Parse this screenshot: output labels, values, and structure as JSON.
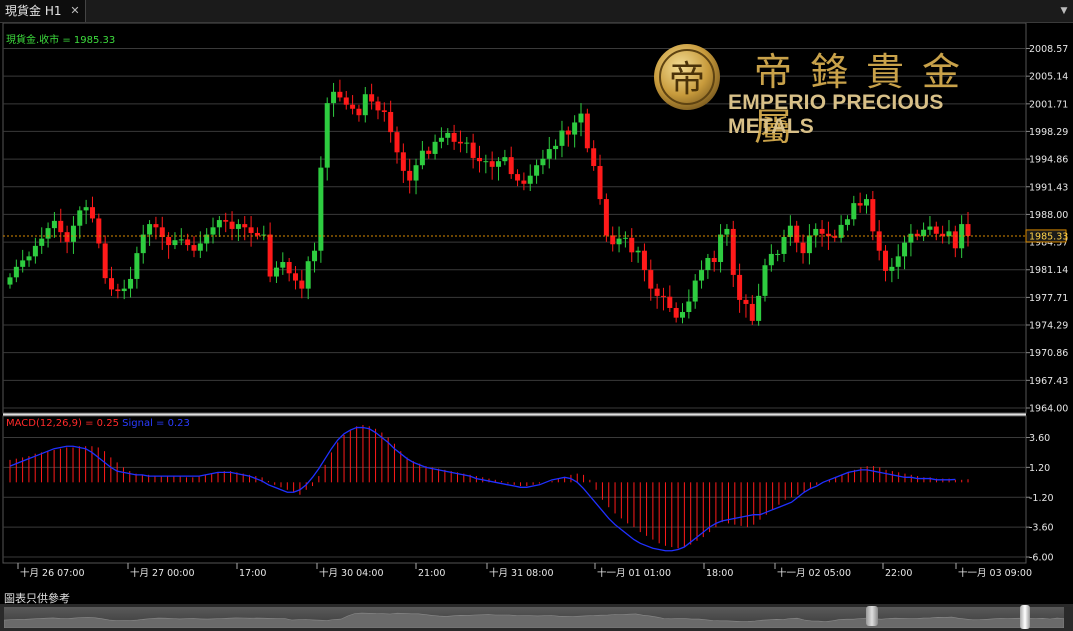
{
  "tab": {
    "title": "現貨金 H1",
    "close_glyph": "✕"
  },
  "window": {
    "dropdown_glyph": "▼"
  },
  "price_legend": "現貨金.收市 = 1985.33",
  "current_price": "1985.33",
  "price_axis": [
    "2008.57",
    "2005.14",
    "2001.71",
    "1998.29",
    "1994.86",
    "1991.43",
    "1988.00",
    "1984.57",
    "1981.14",
    "1977.71",
    "1974.29",
    "1970.86",
    "1967.43",
    "1964.00"
  ],
  "macd_legend": {
    "name": "MACD(12,26,9) = 0.25",
    "signal": "Signal = 0.23"
  },
  "macd_axis": [
    "3.60",
    "1.20",
    "-1.20",
    "-3.60",
    "-6.00"
  ],
  "time_axis": [
    "十月 26 07:00",
    "十月 27 00:00",
    "17:00",
    "十月 30 04:00",
    "21:00",
    "十月 31 08:00",
    "十一月 01 01:00",
    "18:00",
    "十一月 02 05:00",
    "22:00",
    "十一月 03 09:00"
  ],
  "logo": {
    "cn": "帝鋒貴金屬",
    "en": "EMPERIO PRECIOUS METALS",
    "emblem": "帝"
  },
  "disclaimer": "圖表只供參考",
  "colors": {
    "up": "#2ecc40",
    "down": "#ff1a1a",
    "signal": "#2030ff",
    "price_line": "#d98a00",
    "grid": "#3a3a3a",
    "gold": "#c9a24a"
  },
  "chart_data": [
    {
      "type": "candlestick",
      "title": "現貨金 H1",
      "ylim": [
        1964.0,
        2010.0
      ],
      "ticks": [
        2008.57,
        2005.14,
        2001.71,
        1998.29,
        1994.86,
        1991.43,
        1988.0,
        1984.57,
        1981.14,
        1977.71,
        1974.29,
        1970.86,
        1967.43,
        1964.0
      ],
      "last": 1985.33,
      "closes": [
        1980.2,
        1981.5,
        1982.3,
        1982.8,
        1984.1,
        1985.0,
        1986.3,
        1987.2,
        1985.8,
        1984.6,
        1986.6,
        1988.5,
        1988.9,
        1987.5,
        1984.4,
        1980.1,
        1978.7,
        1978.5,
        1978.8,
        1980.0,
        1983.2,
        1985.5,
        1986.8,
        1986.4,
        1985.2,
        1984.2,
        1984.8,
        1984.9,
        1984.2,
        1983.5,
        1984.4,
        1985.5,
        1986.4,
        1987.3,
        1987.1,
        1986.2,
        1986.8,
        1986.4,
        1985.7,
        1985.4,
        1985.5,
        1980.3,
        1981.4,
        1982.1,
        1980.7,
        1979.8,
        1978.8,
        1982.2,
        1983.5,
        1993.8,
        2001.8,
        2003.2,
        2002.5,
        2001.6,
        2001.1,
        2000.3,
        2002.9,
        2002.0,
        2000.9,
        2000.7,
        1998.2,
        1995.7,
        1993.4,
        1992.2,
        1994.1,
        1995.9,
        1995.5,
        1997.0,
        1997.5,
        1998.1,
        1997.0,
        1996.8,
        1996.9,
        1995.0,
        1994.6,
        1994.6,
        1993.9,
        1994.6,
        1995.1,
        1993.0,
        1992.2,
        1991.8,
        1992.8,
        1994.1,
        1994.9,
        1996.1,
        1996.5,
        1998.4,
        1997.9,
        1999.4,
        2000.5,
        1996.2,
        1994.0,
        1989.9,
        1985.4,
        1984.3,
        1985.0,
        1985.1,
        1983.3,
        1983.5,
        1981.1,
        1978.8,
        1977.9,
        1977.8,
        1976.4,
        1975.2,
        1975.9,
        1977.2,
        1979.8,
        1981.1,
        1982.6,
        1982.1,
        1985.5,
        1986.2,
        1980.5,
        1977.4,
        1976.9,
        1974.8,
        1977.9,
        1981.7,
        1983.1,
        1983.1,
        1985.2,
        1986.6,
        1984.5,
        1983.2,
        1985.4,
        1986.2,
        1985.6,
        1985.3,
        1985.1,
        1986.7,
        1987.4,
        1989.4,
        1989.1,
        1989.9,
        1985.9,
        1983.5,
        1981.0,
        1981.5,
        1982.8,
        1984.5,
        1985.6,
        1985.3,
        1986.1,
        1986.5,
        1985.6,
        1985.3,
        1985.9,
        1983.8,
        1986.8,
        1985.33
      ]
    },
    {
      "type": "bar+line",
      "title": "MACD(12,26,9) = 0.25",
      "ylim": [
        -6.6,
        4.4
      ],
      "ticks": [
        3.6,
        1.2,
        -1.2,
        -3.6,
        -6.0
      ],
      "series": [
        {
          "name": "MACD(12,26,9) = 0.25",
          "type": "bar",
          "values": [
            1.8,
            1.9,
            2.0,
            2.1,
            2.3,
            2.4,
            2.5,
            2.6,
            2.7,
            2.8,
            2.8,
            2.9,
            2.9,
            2.9,
            2.8,
            2.5,
            2.0,
            1.6,
            1.2,
            0.9,
            0.7,
            0.6,
            0.6,
            0.5,
            0.5,
            0.5,
            0.5,
            0.5,
            0.4,
            0.4,
            0.5,
            0.6,
            0.7,
            0.8,
            0.9,
            0.9,
            0.8,
            0.7,
            0.6,
            0.5,
            0.4,
            0.1,
            -0.2,
            -0.4,
            -0.6,
            -0.8,
            -1.0,
            -0.6,
            -0.3,
            0.5,
            1.4,
            2.4,
            3.2,
            3.8,
            4.2,
            4.5,
            4.6,
            4.5,
            4.3,
            4.0,
            3.6,
            3.1,
            2.5,
            2.0,
            1.7,
            1.5,
            1.3,
            1.2,
            1.1,
            1.0,
            0.9,
            0.8,
            0.7,
            0.6,
            0.5,
            0.4,
            0.3,
            0.2,
            0.1,
            -0.1,
            -0.2,
            -0.3,
            -0.3,
            -0.2,
            -0.1,
            0.0,
            0.1,
            0.3,
            0.4,
            0.6,
            0.7,
            0.6,
            0.2,
            -0.6,
            -1.4,
            -2.0,
            -2.5,
            -2.9,
            -3.3,
            -3.6,
            -4.0,
            -4.3,
            -4.6,
            -4.9,
            -5.1,
            -5.2,
            -5.3,
            -5.2,
            -5.0,
            -4.7,
            -4.4,
            -4.0,
            -3.6,
            -3.2,
            -3.3,
            -3.4,
            -3.5,
            -3.6,
            -3.4,
            -3.0,
            -2.6,
            -2.2,
            -1.8,
            -1.4,
            -1.2,
            -1.0,
            -0.8,
            -0.5,
            -0.2,
            0.0,
            0.2,
            0.4,
            0.6,
            0.8,
            1.0,
            1.2,
            1.3,
            1.3,
            1.2,
            1.0,
            0.9,
            0.8,
            0.7,
            0.6,
            0.5,
            0.4,
            0.4,
            0.3,
            0.3,
            0.3,
            0.2,
            0.2,
            0.25
          ]
        },
        {
          "name": "Signal = 0.23",
          "type": "line",
          "values": [
            1.3,
            1.5,
            1.7,
            1.9,
            2.1,
            2.3,
            2.5,
            2.7,
            2.8,
            2.9,
            2.9,
            2.8,
            2.7,
            2.4,
            2.0,
            1.6,
            1.2,
            0.9,
            0.8,
            0.7,
            0.6,
            0.6,
            0.5,
            0.5,
            0.5,
            0.5,
            0.5,
            0.5,
            0.5,
            0.5,
            0.5,
            0.6,
            0.7,
            0.8,
            0.8,
            0.8,
            0.7,
            0.6,
            0.5,
            0.3,
            0.1,
            -0.2,
            -0.4,
            -0.6,
            -0.8,
            -0.8,
            -0.6,
            -0.2,
            0.4,
            1.1,
            1.9,
            2.7,
            3.4,
            3.9,
            4.2,
            4.4,
            4.4,
            4.3,
            4.0,
            3.6,
            3.2,
            2.7,
            2.3,
            1.9,
            1.6,
            1.4,
            1.2,
            1.1,
            1.0,
            0.9,
            0.8,
            0.7,
            0.6,
            0.5,
            0.3,
            0.2,
            0.1,
            0.0,
            -0.1,
            -0.2,
            -0.3,
            -0.4,
            -0.4,
            -0.3,
            -0.2,
            0.0,
            0.2,
            0.3,
            0.4,
            0.3,
            0.0,
            -0.5,
            -1.1,
            -1.7,
            -2.3,
            -2.9,
            -3.4,
            -3.8,
            -4.2,
            -4.6,
            -4.9,
            -5.1,
            -5.3,
            -5.4,
            -5.5,
            -5.5,
            -5.4,
            -5.2,
            -4.8,
            -4.4,
            -4.0,
            -3.6,
            -3.3,
            -3.1,
            -3.0,
            -2.9,
            -2.8,
            -2.7,
            -2.6,
            -2.6,
            -2.4,
            -2.2,
            -2.0,
            -1.8,
            -1.6,
            -1.2,
            -0.8,
            -0.5,
            -0.3,
            0.0,
            0.2,
            0.4,
            0.6,
            0.8,
            0.9,
            1.0,
            1.0,
            0.9,
            0.8,
            0.7,
            0.6,
            0.5,
            0.4,
            0.4,
            0.3,
            0.3,
            0.3,
            0.2,
            0.2,
            0.2,
            0.23
          ]
        }
      ]
    }
  ]
}
